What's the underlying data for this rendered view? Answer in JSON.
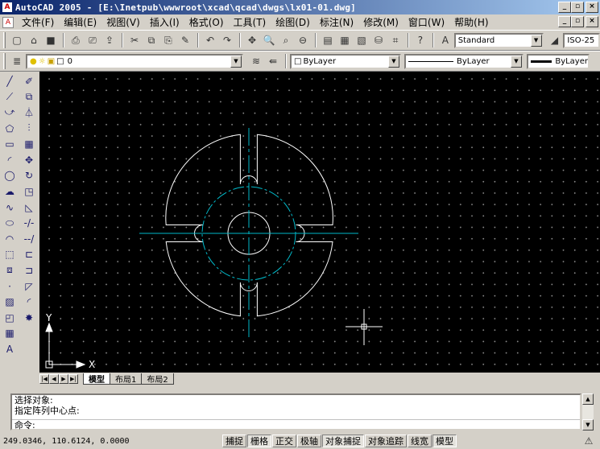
{
  "window": {
    "app_icon_glyph": "A",
    "title": "AutoCAD 2005 - [E:\\Inetpub\\wwwroot\\xcad\\qcad\\dwgs\\lx01-01.dwg]",
    "controls": {
      "minimize": "_",
      "restore": "▫",
      "close": "×"
    }
  },
  "menu": {
    "doc_icon_glyph": "A",
    "items": [
      "文件(F)",
      "编辑(E)",
      "视图(V)",
      "插入(I)",
      "格式(O)",
      "工具(T)",
      "绘图(D)",
      "标注(N)",
      "修改(M)",
      "窗口(W)",
      "帮助(H)"
    ]
  },
  "standard_toolbar": {
    "icons": [
      "new-icon",
      "open-icon",
      "save-icon",
      "plot-icon",
      "plot-preview-icon",
      "publish-icon",
      "cut-icon",
      "copy-icon",
      "paste-icon",
      "match-properties-icon",
      "undo-icon",
      "redo-icon",
      "pan-icon",
      "zoom-realtime-icon",
      "zoom-window-icon",
      "zoom-previous-icon",
      "properties-icon",
      "design-center-icon",
      "tool-palettes-icon",
      "dbconnect-icon",
      "markup-icon",
      "help-icon"
    ],
    "glyphs": [
      "▢",
      "⌂",
      "■",
      "⎙",
      "⎚",
      "⇪",
      "✂",
      "⧉",
      "⎘",
      "✎",
      "↶",
      "↷",
      "✥",
      "🔍",
      "⌕",
      "⊖",
      "▤",
      "▦",
      "▧",
      "⛁",
      "⌗",
      "?"
    ],
    "text_style": "Standard",
    "dim_style": "ISO-25"
  },
  "layers_toolbar": {
    "layer_name": "0",
    "color": "ByLayer",
    "linetype": "ByLayer",
    "lineweight": "ByLayer"
  },
  "draw_toolbar": {
    "icons": [
      "line-icon",
      "construction-line-icon",
      "polyline-icon",
      "polygon-icon",
      "rectangle-icon",
      "arc-icon",
      "circle-icon",
      "revision-cloud-icon",
      "spline-icon",
      "ellipse-icon",
      "ellipse-arc-icon",
      "insert-block-icon",
      "make-block-icon",
      "point-icon",
      "hatch-icon",
      "region-icon",
      "table-icon",
      "multiline-text-icon"
    ],
    "glyphs": [
      "╱",
      "⟋",
      "⤻",
      "⬠",
      "▭",
      "◜",
      "◯",
      "☁",
      "∿",
      "⬭",
      "◠",
      "⬚",
      "⧈",
      "·",
      "▨",
      "◰",
      "▦",
      "A"
    ]
  },
  "modify_toolbar": {
    "icons": [
      "erase-icon",
      "copy-object-icon",
      "mirror-icon",
      "offset-icon",
      "array-icon",
      "move-icon",
      "rotate-icon",
      "scale-icon",
      "stretch-icon",
      "trim-icon",
      "extend-icon",
      "break-at-point-icon",
      "break-icon",
      "chamfer-icon",
      "fillet-icon",
      "explode-icon"
    ],
    "glyphs": [
      "✐",
      "⧉",
      "⏃",
      "⫶",
      "▦",
      "✥",
      "↻",
      "◳",
      "◺",
      "-/-",
      "--/",
      "⊏",
      "⊐",
      "◸",
      "◜",
      "✸"
    ]
  },
  "drawing": {
    "colors": {
      "outline": "#ffffff",
      "center": "#00b8c8",
      "grid": "#8a8a8a"
    },
    "ucs_x": "X",
    "ucs_y": "Y"
  },
  "layout_tabs": {
    "nav": [
      "|◀",
      "◀",
      "▶",
      "▶|"
    ],
    "tabs": [
      "模型",
      "布局1",
      "布局2"
    ],
    "active": "模型"
  },
  "command": {
    "history": [
      "选择对象:",
      "指定阵列中心点:"
    ],
    "prompt": "命令:"
  },
  "status": {
    "coordinates": "249.0346, 110.6124, 0.0000",
    "buttons": [
      {
        "label": "捕捉",
        "on": false
      },
      {
        "label": "栅格",
        "on": true
      },
      {
        "label": "正交",
        "on": false
      },
      {
        "label": "极轴",
        "on": false
      },
      {
        "label": "对象捕捉",
        "on": true
      },
      {
        "label": "对象追踪",
        "on": false
      },
      {
        "label": "线宽",
        "on": false
      },
      {
        "label": "模型",
        "on": true
      }
    ]
  }
}
